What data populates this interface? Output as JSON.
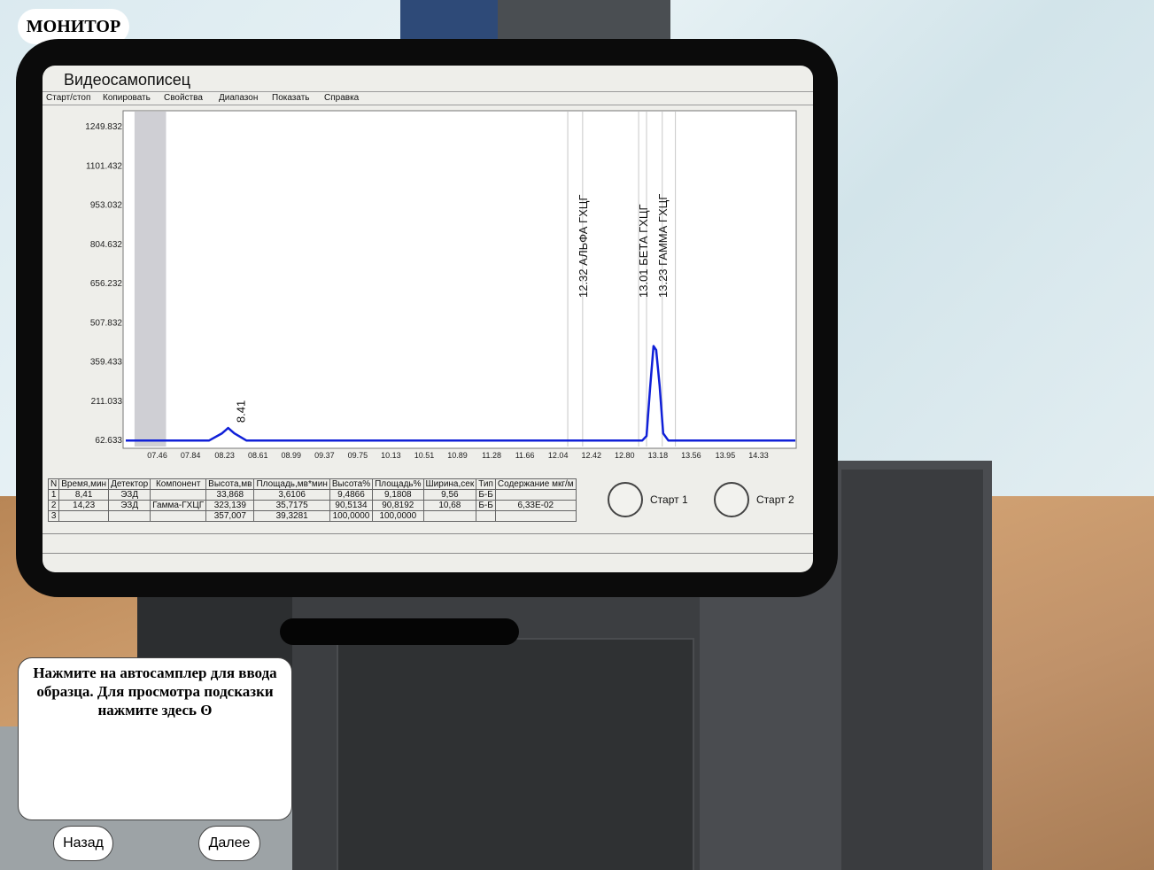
{
  "colors": {
    "trace": "#1020d8",
    "grid_line": "#c8c8c8",
    "shade": "#cfcfd4"
  },
  "header": {
    "title": "МОНИТОР"
  },
  "app": {
    "title": "Видеосамописец",
    "menu": [
      {
        "label": "Старт/стоп"
      },
      {
        "label": "Копировать"
      },
      {
        "label": "Свойства"
      },
      {
        "label": "Диапазон"
      },
      {
        "label": "Показать"
      },
      {
        "label": "Справка"
      }
    ]
  },
  "chart_data": {
    "type": "line",
    "title": "",
    "xlabel": "",
    "ylabel": "",
    "x_ticks": [
      "07.46",
      "07.84",
      "08.23",
      "08.61",
      "08.99",
      "09.37",
      "09.75",
      "10.13",
      "10.51",
      "10.89",
      "11.28",
      "11.66",
      "12.04",
      "12.42",
      "12.80",
      "13.18",
      "13.56",
      "13.95",
      "14.33"
    ],
    "y_ticks": [
      "62.633",
      "211.033",
      "359.433",
      "507.832",
      "656.232",
      "804.632",
      "953.032",
      "1101.432",
      "1249.832"
    ],
    "xlim": [
      7.1,
      14.75
    ],
    "ylim": [
      40,
      1300
    ],
    "series": [
      {
        "values": [
          [
            7.1,
            62.6
          ],
          [
            8.05,
            62.6
          ],
          [
            8.2,
            90
          ],
          [
            8.27,
            110
          ],
          [
            8.34,
            90
          ],
          [
            8.48,
            62.6
          ],
          [
            13.0,
            62.6
          ],
          [
            13.05,
            80
          ],
          [
            13.09,
            260
          ],
          [
            13.13,
            420
          ],
          [
            13.16,
            405
          ],
          [
            13.2,
            270
          ],
          [
            13.24,
            90
          ],
          [
            13.3,
            62.6
          ],
          [
            14.75,
            62.6
          ]
        ]
      }
    ],
    "peak_labels": [
      {
        "x": 8.41,
        "y": 110,
        "text": "8.41"
      },
      {
        "x": 12.32,
        "text": "12.32 АЛЬФА ГХЦГ"
      },
      {
        "x": 13.01,
        "text": "13.01 БЕТА ГХЦГ"
      },
      {
        "x": 13.23,
        "text": "13.23 ГАММА ГХЦГ"
      }
    ],
    "shaded_x": [
      7.2,
      7.56
    ],
    "marker_lines": [
      12.15,
      12.32,
      12.96,
      13.05,
      13.23,
      13.38
    ],
    "grid": false
  },
  "results": {
    "headers": [
      "N",
      "Время,мин",
      "Детектор",
      "Компонент",
      "Высота,мв",
      "Площадь,мв*мин",
      "Высота%",
      "Площадь%",
      "Ширина,сек",
      "Тип",
      "Содержание мкг/м"
    ],
    "rows": [
      [
        "1",
        "8,41",
        "ЭЗД",
        "",
        "33,868",
        "3,6106",
        "9,4866",
        "9,1808",
        "9,56",
        "Б-Б",
        ""
      ],
      [
        "2",
        "14,23",
        "ЭЗД",
        "Гамма-ГХЦГ",
        "323,139",
        "35,7175",
        "90,5134",
        "90,8192",
        "10,68",
        "Б-Б",
        "6,33Е-02"
      ],
      [
        "3",
        "",
        "",
        "",
        "357,007",
        "39,3281",
        "100,0000",
        "100,0000",
        "",
        "",
        ""
      ]
    ]
  },
  "start_buttons": [
    {
      "label": "Старт 1"
    },
    {
      "label": "Старт 2"
    }
  ],
  "hint": {
    "text": "Нажмите на автосамплер для ввода образца. Для просмотра подсказки нажмите здесь ʘ"
  },
  "nav": {
    "back": "Назад",
    "next": "Далее"
  }
}
